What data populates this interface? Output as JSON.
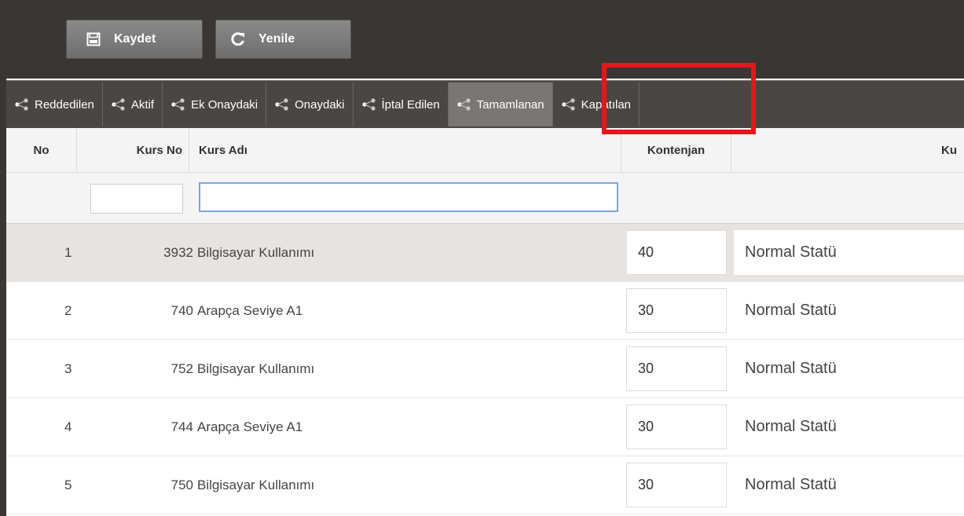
{
  "toolbar": {
    "save_label": "Kaydet",
    "refresh_label": "Yenile"
  },
  "tabs": [
    {
      "label": "Reddedilen"
    },
    {
      "label": "Aktif"
    },
    {
      "label": "Ek Onaydaki"
    },
    {
      "label": "Onaydaki"
    },
    {
      "label": "İptal Edilen"
    },
    {
      "label": "Tamamlanan",
      "active": true
    },
    {
      "label": "Kapatılan"
    }
  ],
  "table": {
    "headers": {
      "no": "No",
      "kurs_no": "Kurs No",
      "kurs_adi": "Kurs Adı",
      "kontenjan": "Kontenjan",
      "extra": "Ku"
    },
    "filter": {
      "kurs_no": "",
      "kurs_adi": ""
    },
    "rows": [
      {
        "no": "1",
        "kurs_no": "3932",
        "kurs_adi": "Bilgisayar Kullanımı",
        "kontenjan": "40",
        "statu": "Normal Statü"
      },
      {
        "no": "2",
        "kurs_no": "740",
        "kurs_adi": "Arapça Seviye A1",
        "kontenjan": "30",
        "statu": "Normal Statü"
      },
      {
        "no": "3",
        "kurs_no": "752",
        "kurs_adi": "Bilgisayar Kullanımı",
        "kontenjan": "30",
        "statu": "Normal Statü"
      },
      {
        "no": "4",
        "kurs_no": "744",
        "kurs_adi": "Arapça Seviye A1",
        "kontenjan": "30",
        "statu": "Normal Statü"
      },
      {
        "no": "5",
        "kurs_no": "750",
        "kurs_adi": "Bilgisayar Kullanımı",
        "kontenjan": "30",
        "statu": "Normal Statü"
      }
    ]
  },
  "colors": {
    "highlight": "#e8151b",
    "toolbar_bg": "#3a3633",
    "tab_bg": "#4a4643"
  },
  "icons": {
    "save": "floppy-icon",
    "refresh": "refresh-icon",
    "tab": "share-icon"
  }
}
